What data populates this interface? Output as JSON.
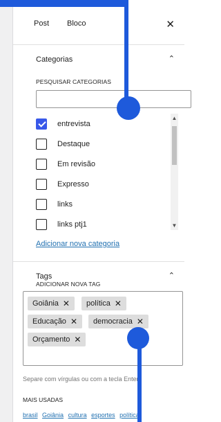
{
  "tabs": {
    "post": "Post",
    "block": "Bloco",
    "close": "✕"
  },
  "categories": {
    "title": "Categorias",
    "chevron": "⌃",
    "search_label": "PESQUISAR CATEGORIAS",
    "search_value": "",
    "items": [
      {
        "label": "entrevista",
        "checked": true
      },
      {
        "label": "Destaque",
        "checked": false
      },
      {
        "label": "Em revisão",
        "checked": false
      },
      {
        "label": "Expresso",
        "checked": false
      },
      {
        "label": "links",
        "checked": false
      },
      {
        "label": "links ptj1",
        "checked": false
      }
    ],
    "add_link": "Adicionar nova categoria"
  },
  "tags": {
    "title": "Tags",
    "chevron": "⌃",
    "add_label": "ADICIONAR NOVA TAG",
    "chips": [
      "Goiânia",
      "política",
      "Educação",
      "democracia",
      "Orçamento"
    ],
    "remove_glyph": "✕",
    "help": "Separe com vírgulas ou com a tecla Enter.",
    "most_used_label": "MAIS USADAS",
    "most_used": [
      "brasil",
      "Goiânia",
      "cultura",
      "esportes",
      "política"
    ]
  },
  "scrollbar": {
    "up": "▲",
    "down": "▼"
  },
  "colors": {
    "accent": "#3858e9",
    "link": "#2271b1",
    "overlay": "#1e5adb"
  }
}
